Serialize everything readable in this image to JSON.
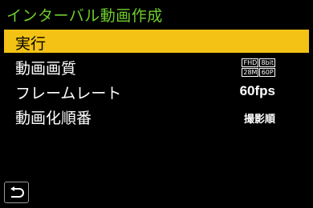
{
  "header": {
    "title": "インターバル動画作成"
  },
  "menu": {
    "items": [
      {
        "label": "実行"
      },
      {
        "label": "動画画質",
        "quality": [
          "FHD",
          "8bit",
          "28M",
          "60P"
        ]
      },
      {
        "label": "フレームレート",
        "value": "60fps"
      },
      {
        "label": "動画化順番",
        "value": "撮影順"
      }
    ]
  },
  "footer": {
    "back_icon": "return-icon"
  },
  "colors": {
    "title": "#6fce2c",
    "highlight": "#f3c215",
    "background": "#000000"
  }
}
